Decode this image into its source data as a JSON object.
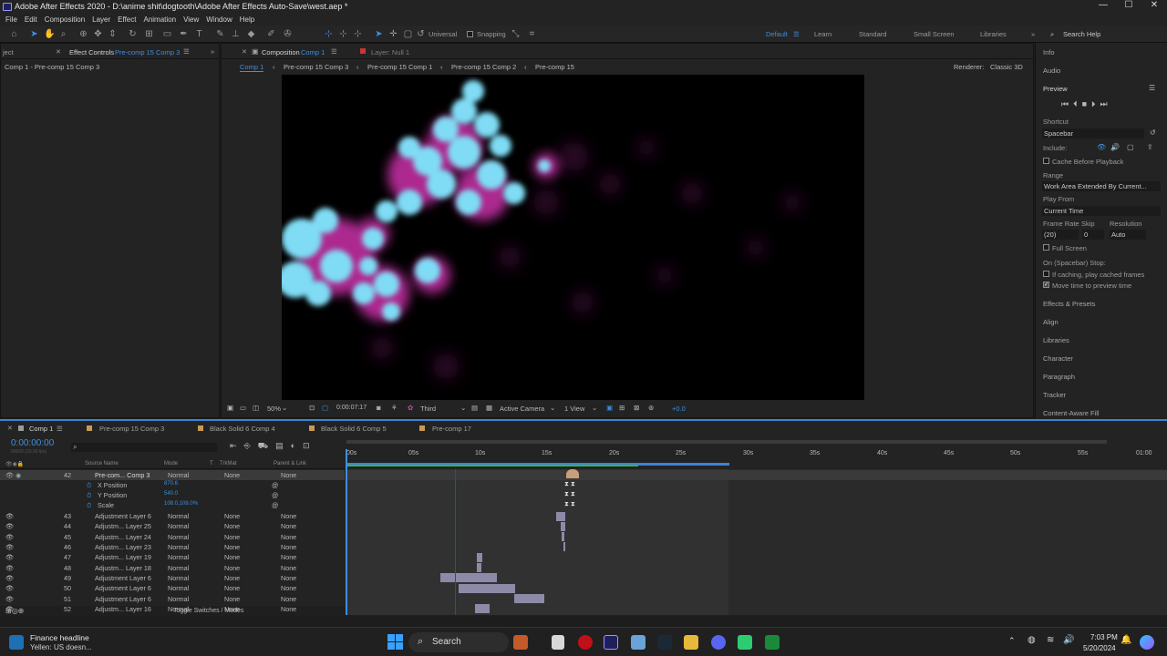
{
  "titlebar": {
    "title": "Adobe After Effects 2020 - D:\\anime shit\\dogtooth\\Adobe After Effects Auto-Save\\west.aep *",
    "min": "—",
    "max": "☐",
    "close": "✕"
  },
  "menu": [
    "File",
    "Edit",
    "Composition",
    "Layer",
    "Effect",
    "Animation",
    "View",
    "Window",
    "Help"
  ],
  "toolbar": {
    "universal": "Universal",
    "snapping": "Snapping",
    "workspaces": [
      "Default",
      "Learn",
      "Standard",
      "Small Screen",
      "Libraries"
    ],
    "search": "Search Help"
  },
  "left": {
    "tab_prefix": "ject",
    "tab": "Effect Controls",
    "tab_link": "Pre-comp 15 Comp 3",
    "subtitle": "Comp 1 - Pre-comp 15 Comp 3"
  },
  "comp": {
    "tab": "Composition",
    "tab_link": "Comp 1",
    "layer_tab": "Layer: Null 1",
    "breadcrumbs": [
      "Comp 1",
      "Pre-comp 15 Comp 3",
      "Pre-comp 15 Comp 1",
      "Pre-comp 15 Comp 2",
      "Pre-comp 15"
    ],
    "renderer_label": "Renderer:",
    "renderer": "Classic 3D",
    "bottom": {
      "zoom": "50%",
      "time": "0:00:07:17",
      "res": "Third",
      "camera": "Active Camera",
      "view": "1 View",
      "exposure": "+0.0"
    }
  },
  "right": {
    "info": "Info",
    "audio": "Audio",
    "preview": "Preview",
    "shortcut_label": "Shortcut",
    "shortcut": "Spacebar",
    "include": "Include:",
    "cache": "Cache Before Playback",
    "range_label": "Range",
    "range": "Work Area Extended By Current...",
    "playfrom_label": "Play From",
    "playfrom": "Current Time",
    "fr_label": "Frame Rate",
    "skip_label": "Skip",
    "res_label": "Resolution",
    "fr": "(20)",
    "skip": "0",
    "res": "Auto",
    "fullscreen": "Full Screen",
    "stop_label": "On (Spacebar) Stop:",
    "ifcaching": "If caching, play cached frames",
    "movetime": "Move time to preview time",
    "panels": [
      "Effects & Presets",
      "Align",
      "Libraries",
      "Character",
      "Paragraph",
      "Tracker",
      "Content-Aware Fill"
    ]
  },
  "timeline": {
    "tabs": [
      "Comp 1",
      "Pre-comp 15 Comp 3",
      "Black Solid 6 Comp 4",
      "Black Solid 6 Comp 5",
      "Pre-comp 17"
    ],
    "time": "0:00:00:00",
    "time_sub": "00000 (20.00 fps)",
    "cols": {
      "source": "Source Name",
      "mode": "Mode",
      "t": "T",
      "trkmat": "TrkMat",
      "parent": "Parent & Link"
    },
    "ruler": [
      "00s",
      "05s",
      "10s",
      "15s",
      "20s",
      "25s",
      "30s",
      "35s",
      "40s",
      "45s",
      "50s",
      "55s",
      "01:00"
    ],
    "props": [
      {
        "name": "X Position",
        "val": "870.6"
      },
      {
        "name": "Y Position",
        "val": "540.0"
      },
      {
        "name": "Scale",
        "val": "108.0,108.0%"
      }
    ],
    "layers": [
      {
        "num": "42",
        "name": "Pre-com... Comp 3",
        "mode": "Normal",
        "trk": "None",
        "par": "None"
      },
      {
        "num": "43",
        "name": "Adjustment Layer 6",
        "mode": "Normal",
        "trk": "None",
        "par": "None"
      },
      {
        "num": "44",
        "name": "Adjustm... Layer 25",
        "mode": "Normal",
        "trk": "None",
        "par": "None"
      },
      {
        "num": "45",
        "name": "Adjustm... Layer 24",
        "mode": "Normal",
        "trk": "None",
        "par": "None"
      },
      {
        "num": "46",
        "name": "Adjustm... Layer 23",
        "mode": "Normal",
        "trk": "None",
        "par": "None"
      },
      {
        "num": "47",
        "name": "Adjustm... Layer 19",
        "mode": "Normal",
        "trk": "None",
        "par": "None"
      },
      {
        "num": "48",
        "name": "Adjustm... Layer 18",
        "mode": "Normal",
        "trk": "None",
        "par": "None"
      },
      {
        "num": "49",
        "name": "Adjustment Layer 6",
        "mode": "Normal",
        "trk": "None",
        "par": "None"
      },
      {
        "num": "50",
        "name": "Adjustment Layer 6",
        "mode": "Normal",
        "trk": "None",
        "par": "None"
      },
      {
        "num": "51",
        "name": "Adjustment Layer 6",
        "mode": "Normal",
        "trk": "None",
        "par": "None"
      },
      {
        "num": "52",
        "name": "Adjustm... Layer 16",
        "mode": "Normal",
        "trk": "None",
        "par": "None"
      }
    ],
    "toggle": "Toggle Switches / Modes"
  },
  "taskbar": {
    "news_title": "Finance headline",
    "news_sub": "Yellen: US doesn...",
    "search": "Search",
    "time": "7:03 PM",
    "date": "5/20/2024"
  }
}
